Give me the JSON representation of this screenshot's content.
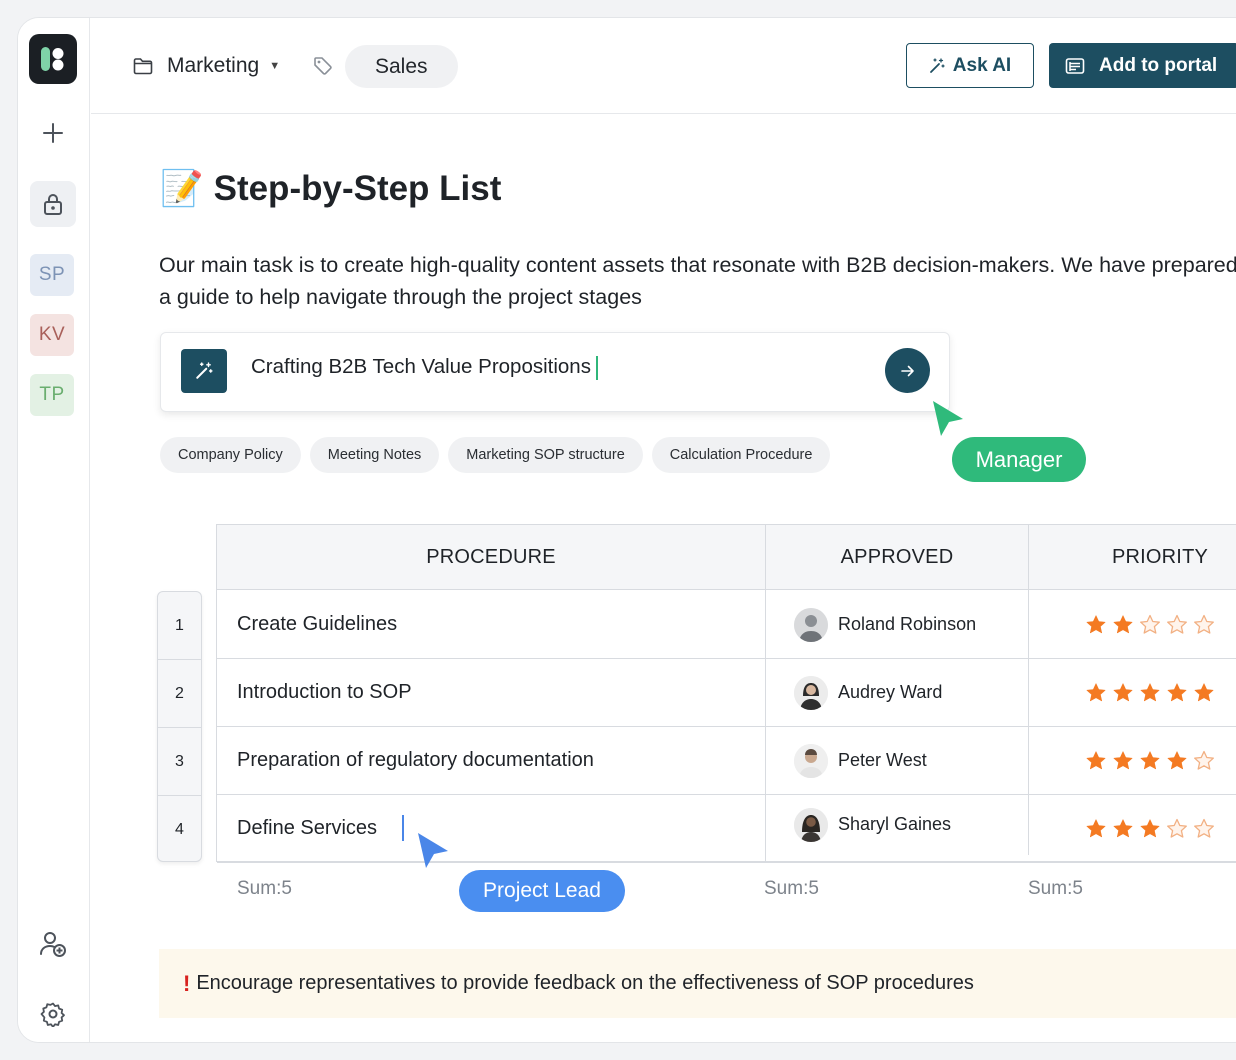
{
  "header": {
    "folder_label": "Marketing",
    "tag_label": "Sales",
    "ask_ai_label": "Ask AI",
    "portal_label": "Add to portal"
  },
  "sidebar": {
    "avatars": [
      {
        "initials": "SP",
        "color": "#7d93b5"
      },
      {
        "initials": "KV",
        "color": "#a9605a"
      },
      {
        "initials": "TP",
        "color": "#6aae6f"
      }
    ]
  },
  "page": {
    "emoji": "📝",
    "title": "Step-by-Step List",
    "description": "Our main task is to create high-quality content assets that resonate with B2B decision-makers. We have prepared a guide to help navigate through the project stages"
  },
  "prompt": {
    "value": "Crafting B2B Tech Value Propositions"
  },
  "chips": [
    "Company Policy",
    "Meeting Notes",
    "Marketing SOP structure",
    "Calculation Procedure"
  ],
  "cursors": {
    "manager_label": "Manager",
    "lead_label": "Project Lead"
  },
  "table": {
    "headers": {
      "procedure": "PROCEDURE",
      "approved": "APPROVED",
      "priority": "PRIORITY"
    },
    "rows": [
      {
        "num": "1",
        "procedure": "Create Guidelines",
        "approved": "Roland Robinson",
        "priority": 2
      },
      {
        "num": "2",
        "procedure": "Introduction to SOP",
        "approved": "Audrey Ward",
        "priority": 5
      },
      {
        "num": "3",
        "procedure": "Preparation of regulatory documentation",
        "approved": "Peter West",
        "priority": 4
      },
      {
        "num": "4",
        "procedure": "Define Services",
        "approved": "Sharyl Gaines",
        "priority": 3
      }
    ],
    "sums": {
      "procedure": "Sum:5",
      "approved": "Sum:5",
      "priority": "Sum:5"
    }
  },
  "note": {
    "mark": "!",
    "text": "Encourage representatives to provide feedback on the effectiveness of SOP procedures"
  },
  "colors": {
    "brand": "#1d4e61",
    "manager": "#2fba7b",
    "lead": "#4a8ef0",
    "star": "#f47a22"
  }
}
